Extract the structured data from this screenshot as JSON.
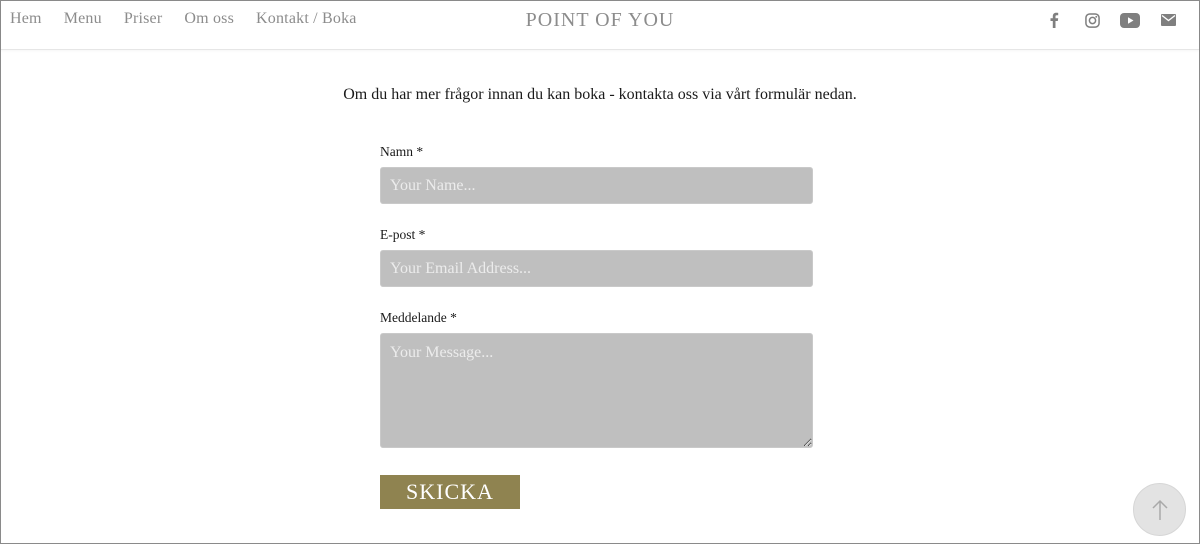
{
  "header": {
    "nav": [
      "Hem",
      "Menu",
      "Priser",
      "Om oss",
      "Kontakt / Boka"
    ],
    "brand": "POINT OF YOU",
    "social_icons": [
      "facebook-icon",
      "instagram-icon",
      "youtube-icon",
      "mail-icon"
    ]
  },
  "intro": "Om du har mer frågor innan du kan boka - kontakta oss via vårt formulär nedan.",
  "form": {
    "name_label": "Namn *",
    "name_placeholder": "Your Name...",
    "email_label": "E-post *",
    "email_placeholder": "Your Email Address...",
    "message_label": "Meddelande *",
    "message_placeholder": "Your Message...",
    "submit_label": "SKICKA"
  },
  "colors": {
    "nav_text": "#8c8c8c",
    "field_bg": "#bfbfbf",
    "submit_bg": "#8f8350"
  },
  "scroll_top_icon": "arrow-up-icon"
}
